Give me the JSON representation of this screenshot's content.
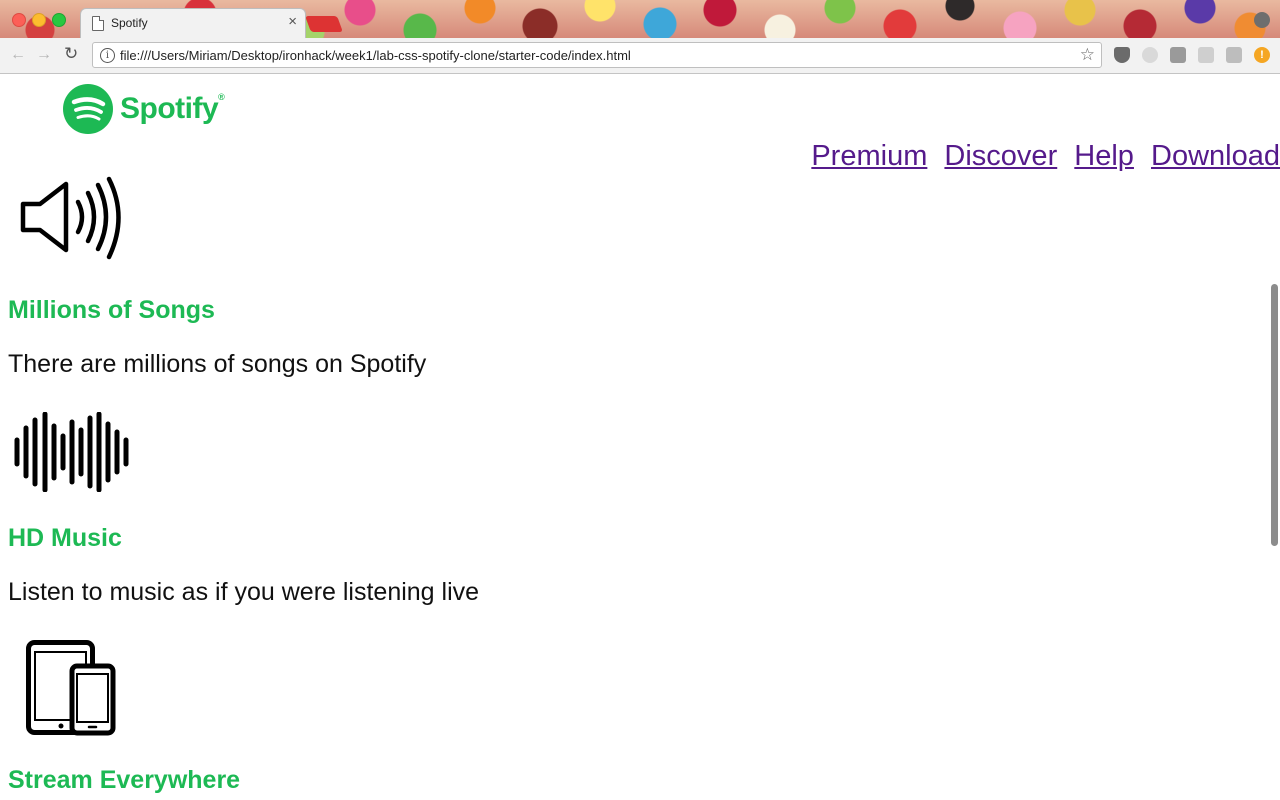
{
  "browser": {
    "tab_title": "Spotify",
    "tab_close": "×",
    "url": "file:///Users/Miriam/Desktop/ironhack/week1/lab-css-spotify-clone/starter-code/index.html"
  },
  "logo": {
    "text": "Spotify",
    "trademark": "®",
    "color": "#1db954"
  },
  "nav": {
    "items": [
      {
        "label": "Premium"
      },
      {
        "label": "Discover"
      },
      {
        "label": "Help"
      },
      {
        "label": "Download"
      }
    ]
  },
  "features": [
    {
      "icon": "speaker-icon",
      "title": "Millions of Songs",
      "text": "There are millions of songs on Spotify"
    },
    {
      "icon": "soundwave-icon",
      "title": "HD Music",
      "text": "Listen to music as if you were listening live"
    },
    {
      "icon": "devices-icon",
      "title": "Stream Everywhere",
      "text": ""
    }
  ],
  "colors": {
    "accent": "#1db954",
    "link_visited": "#551a8b"
  }
}
